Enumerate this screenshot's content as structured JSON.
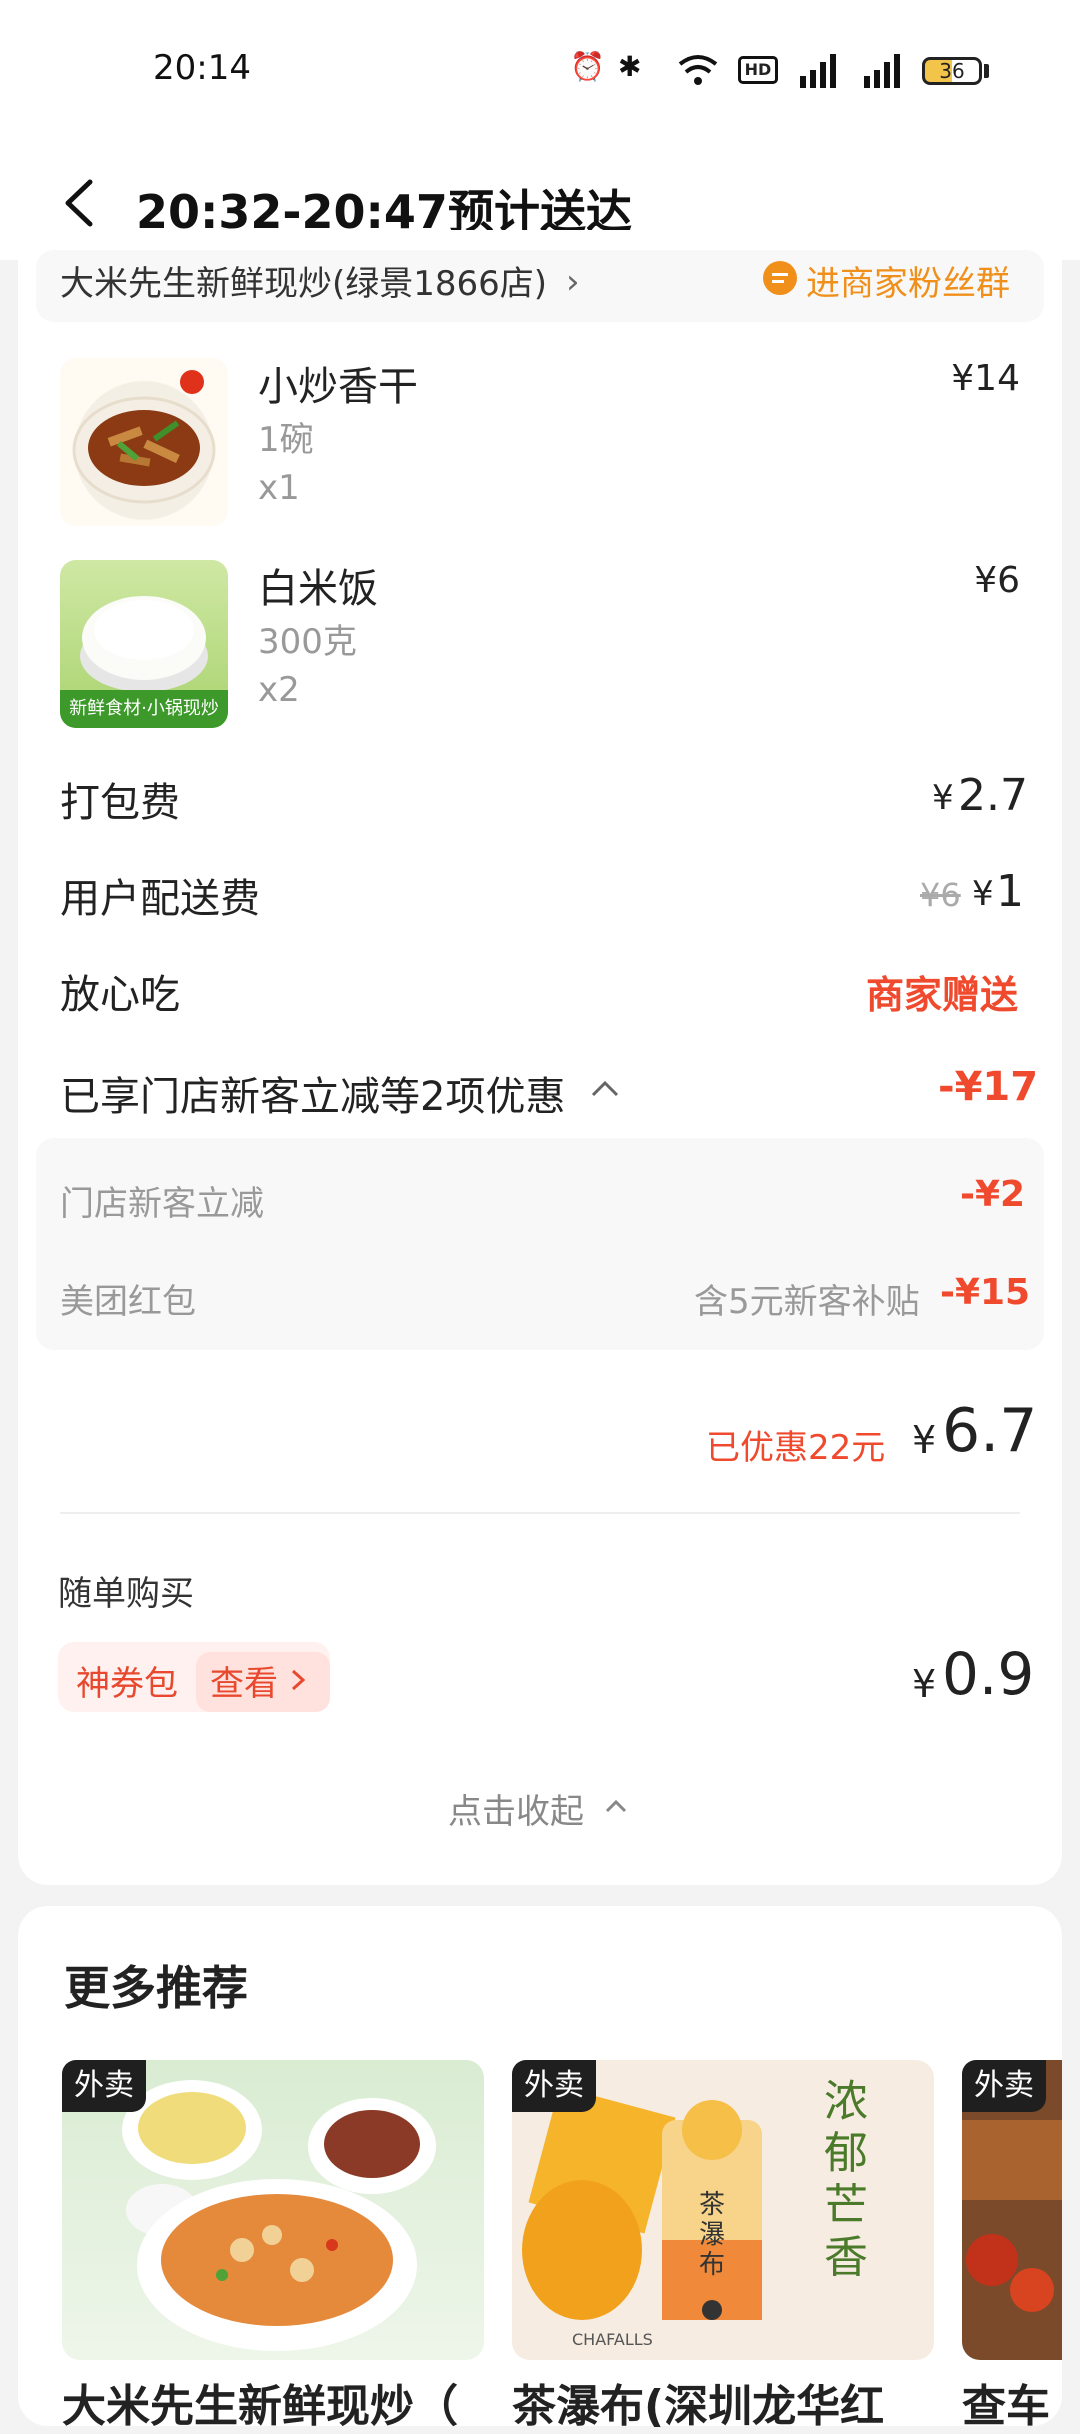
{
  "status_bar": {
    "time": "20:14",
    "battery": "36"
  },
  "header": {
    "title": "20:32-20:47预计送达"
  },
  "store": {
    "name": "大米先生新鲜现炒(绿景1866店)",
    "fan_group": "进商家粉丝群"
  },
  "items": [
    {
      "name": "小炒香干",
      "spec": "1碗",
      "qty": "x1",
      "price": "¥14"
    },
    {
      "name": "白米饭",
      "spec": "300克",
      "qty": "x2",
      "price": "¥6"
    }
  ],
  "rice_image_caption": "新鲜食材·小锅现炒",
  "fees": {
    "packing_label": "打包费",
    "packing_value": "2.7",
    "delivery_label": "用户配送费",
    "delivery_original": "¥6",
    "delivery_value": "1",
    "safe_label": "放心吃",
    "safe_value": "商家赠送"
  },
  "discounts": {
    "summary_label": "已享门店新客立减等2项优惠",
    "summary_value": "-¥17",
    "rows": [
      {
        "label": "门店新客立减",
        "note": "",
        "value": "-¥2"
      },
      {
        "label": "美团红包",
        "note": "含5元新客补贴",
        "value": "-¥15"
      }
    ]
  },
  "total": {
    "saved": "已优惠22元",
    "currency": "¥",
    "amount": "6.7"
  },
  "addon": {
    "title": "随单购买",
    "coupon_name": "神券包",
    "view_label": "查看",
    "currency": "¥",
    "price": "0.9"
  },
  "collapse_label": "点击收起",
  "recommend": {
    "title": "更多推荐",
    "items": [
      {
        "badge": "外卖",
        "name": "大米先生新鲜现炒（"
      },
      {
        "badge": "外卖",
        "name": "茶瀑布(深圳龙华红",
        "brand": "CHAFALLS",
        "slogan": "浓郁芒香",
        "cup_label": "茶瀑布"
      },
      {
        "badge": "外卖",
        "name": "查车"
      }
    ]
  }
}
